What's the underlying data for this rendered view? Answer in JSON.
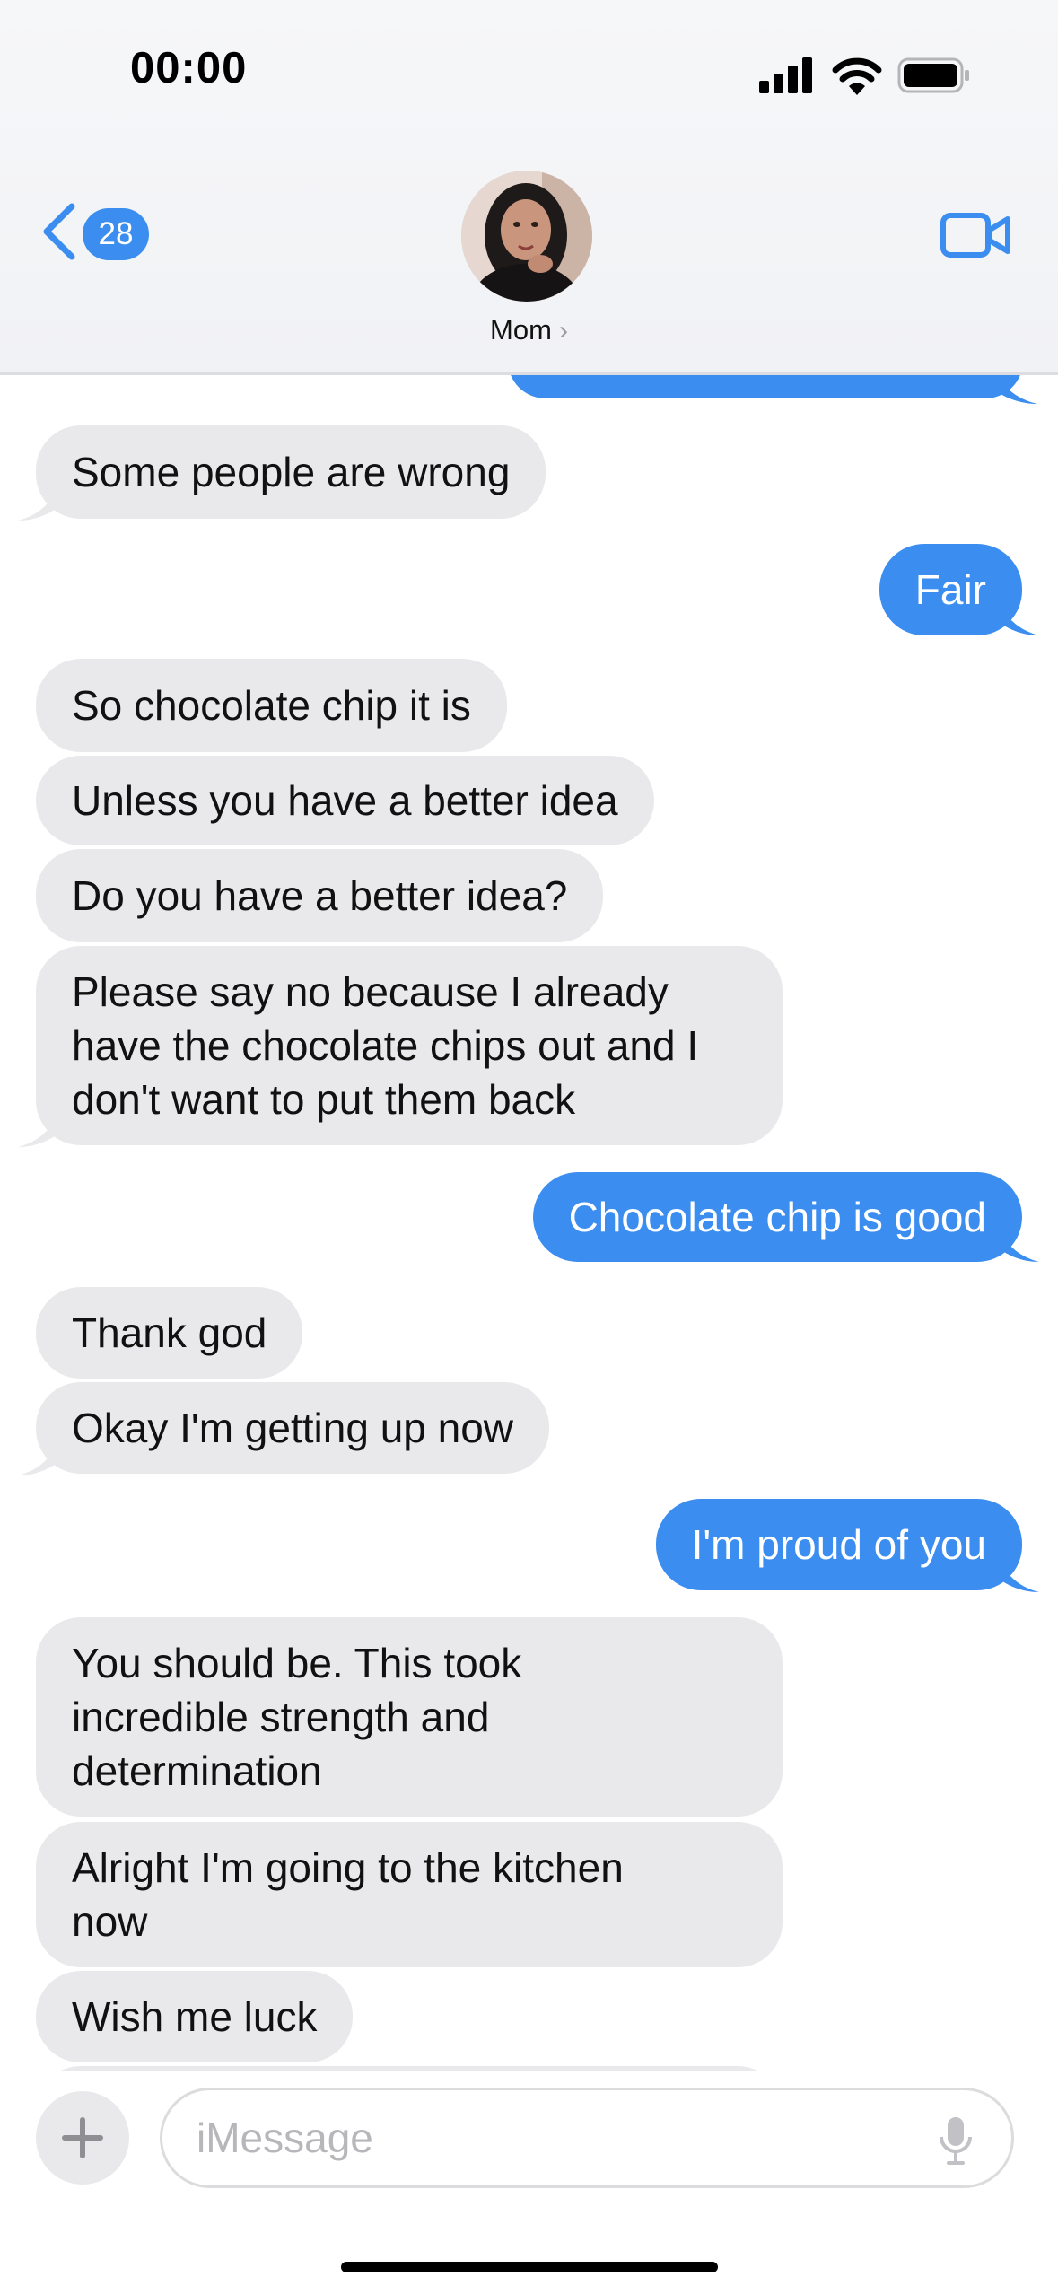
{
  "status_bar": {
    "time": "00:00"
  },
  "header": {
    "back_badge": "28",
    "contact_name": "Mom",
    "name_chevron": "›"
  },
  "messages": [
    {
      "from": "me",
      "text": ""
    },
    {
      "from": "them",
      "text": "Some people are wrong"
    },
    {
      "from": "me",
      "text": "Fair"
    },
    {
      "from": "them",
      "text": "So chocolate chip it is"
    },
    {
      "from": "them",
      "text": "Unless you have a better idea"
    },
    {
      "from": "them",
      "text": "Do you have a better idea?"
    },
    {
      "from": "them",
      "lines": [
        "Please say no because I already",
        "have the chocolate chips out and I",
        "don't want to put them back"
      ]
    },
    {
      "from": "me",
      "text": "Chocolate chip is good"
    },
    {
      "from": "them",
      "text": "Thank god"
    },
    {
      "from": "them",
      "text": "Okay I'm getting up now"
    },
    {
      "from": "me",
      "text": "I'm proud of you"
    },
    {
      "from": "them",
      "lines": [
        "You should be. This took",
        "incredible strength and",
        "determination"
      ]
    },
    {
      "from": "them",
      "lines": [
        "Alright I'm going to the kitchen",
        "now"
      ]
    },
    {
      "from": "them",
      "text": "Wish me luck"
    }
  ],
  "composer": {
    "placeholder": "iMessage"
  },
  "colors": {
    "accent": "#3b8df0",
    "incoming_bubble": "#e9e9eb",
    "header_bg": "#f3f4f6"
  },
  "icons": [
    "signal-icon",
    "wifi-icon",
    "battery-icon",
    "back-chevron-icon",
    "video-camera-icon",
    "plus-icon",
    "microphone-icon"
  ]
}
